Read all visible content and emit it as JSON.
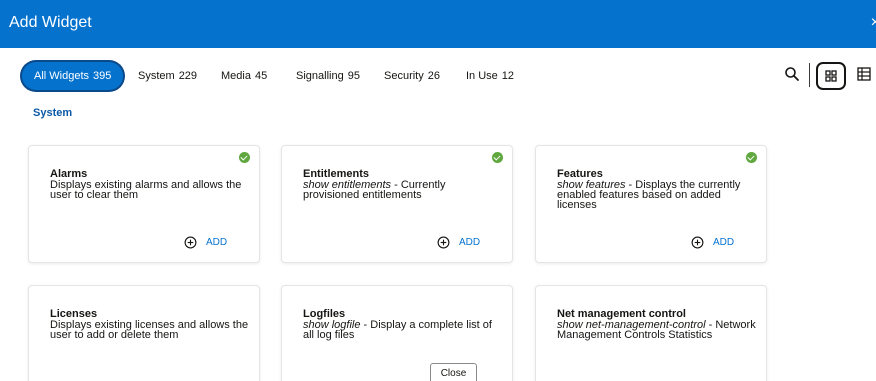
{
  "dialog": {
    "title": "Add Widget",
    "close_glyph": "×"
  },
  "tabs": [
    {
      "label": "All Widgets",
      "count": "395",
      "active": true
    },
    {
      "label": "System",
      "count": "229"
    },
    {
      "label": "Media",
      "count": "45"
    },
    {
      "label": "Signalling",
      "count": "95"
    },
    {
      "label": "Security",
      "count": "26"
    },
    {
      "label": "In Use",
      "count": "12"
    }
  ],
  "toolbar": {
    "search_icon": "search-icon",
    "grid_view_icon": "grid-view-icon",
    "table_view_icon": "table-view-icon"
  },
  "section": {
    "title": "System"
  },
  "cards": [
    {
      "title": "Alarms",
      "cmd": "",
      "desc": "Displays existing alarms and allows the user to clear them",
      "added": true,
      "add_label": "ADD"
    },
    {
      "title": "Entitlements",
      "cmd": "show entitlements",
      "desc": " - Currently provisioned entitlements",
      "added": true,
      "add_label": "ADD"
    },
    {
      "title": "Features",
      "cmd": "show features",
      "desc": " - Displays the currently enabled features based on added licenses",
      "added": true,
      "add_label": "ADD"
    },
    {
      "title": "Licenses",
      "cmd": "",
      "desc": "Displays existing licenses and allows the user to add or delete them",
      "added": false
    },
    {
      "title": "Logfiles",
      "cmd": "show logfile",
      "desc": " - Display a complete list of all log files",
      "added": false
    },
    {
      "title": "Net management control",
      "cmd": "show net-management-control",
      "desc": " - Network Management Controls Statistics",
      "added": false
    }
  ],
  "footer": {
    "close_label": "Close"
  },
  "colors": {
    "accent": "#0572ce",
    "check": "#5fa73e",
    "section": "#0b5aa8"
  }
}
